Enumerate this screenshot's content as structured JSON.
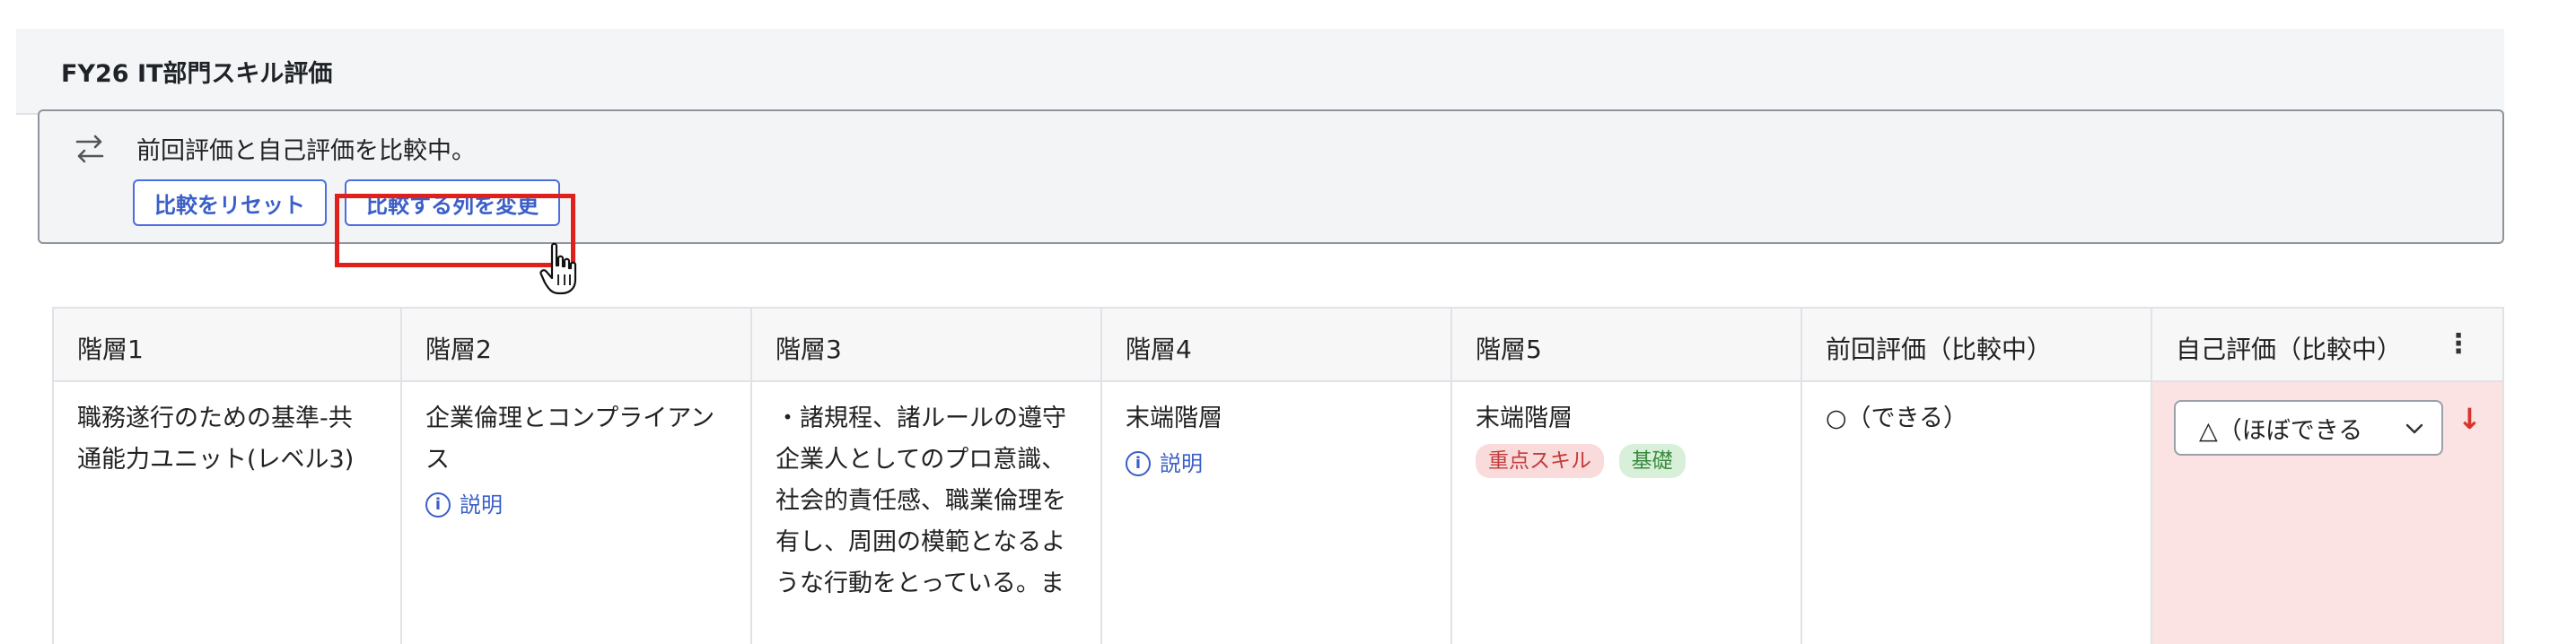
{
  "panel": {
    "title": "FY26 IT部門スキル評価"
  },
  "compare": {
    "message": "前回評価と自己評価を比較中。",
    "reset_label": "比較をリセット",
    "change_label": "比較する列を変更",
    "icon": "sync-arrows-icon"
  },
  "table": {
    "headers": [
      "階層1",
      "階層2",
      "階層3",
      "階層4",
      "階層5",
      "前回評価（比較中）",
      "自己評価（比較中）"
    ],
    "row": {
      "level1": [
        "職務遂行のための基準-共",
        "通能力ユニット(レベル3)"
      ],
      "level2": [
        "企業倫理とコンプライアン",
        "ス"
      ],
      "level2_link": "説明",
      "level3": [
        "・諸規程、諸ルールの遵守",
        "企業人としてのプロ意識、",
        "社会的責任感、職業倫理を",
        "有し、周囲の模範となるよ",
        "うな行動をとっている。ま"
      ],
      "level4": "末端階層",
      "level4_link": "説明",
      "level5": "末端階層",
      "tags": [
        "重点スキル",
        "基礎"
      ],
      "previous": "○（できる）",
      "self_value": "△（ほぼできる"
    }
  },
  "colors": {
    "accent": "#4a6ee0",
    "highlight": "#e0211b",
    "self_bg": "#fbe3e3",
    "down_arrow": "#d9342b"
  }
}
